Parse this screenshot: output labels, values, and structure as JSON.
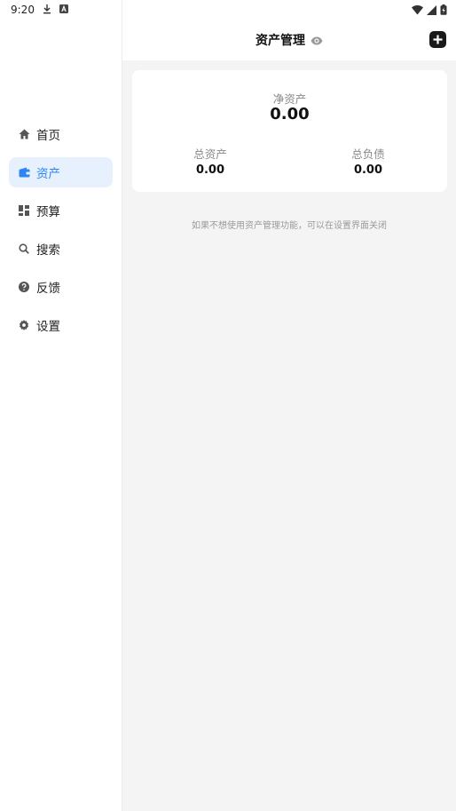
{
  "status_bar": {
    "time": "9:20",
    "icons": [
      "download-icon",
      "notification-a-icon",
      "wifi-icon",
      "signal-icon",
      "battery-charging-icon"
    ]
  },
  "sidebar": {
    "items": [
      {
        "label": "首页",
        "icon": "home-icon",
        "active": false
      },
      {
        "label": "资产",
        "icon": "wallet-icon",
        "active": true
      },
      {
        "label": "预算",
        "icon": "dashboard-icon",
        "active": false
      },
      {
        "label": "搜索",
        "icon": "search-icon",
        "active": false
      },
      {
        "label": "反馈",
        "icon": "help-circle-icon",
        "active": false
      },
      {
        "label": "设置",
        "icon": "gear-icon",
        "active": false
      }
    ]
  },
  "header": {
    "title": "资产管理",
    "visibility_icon": "eye-icon",
    "add_icon": "plus-square-icon"
  },
  "summary": {
    "net_label": "净资产",
    "net_value": "0.00",
    "total_assets_label": "总资产",
    "total_assets_value": "0.00",
    "total_liabilities_label": "总负债",
    "total_liabilities_value": "0.00"
  },
  "hint": "如果不想使用资产管理功能，可以在设置界面关闭",
  "colors": {
    "accent": "#2e86f5",
    "active_bg": "#e7f1fe",
    "content_bg": "#f4f4f4"
  }
}
